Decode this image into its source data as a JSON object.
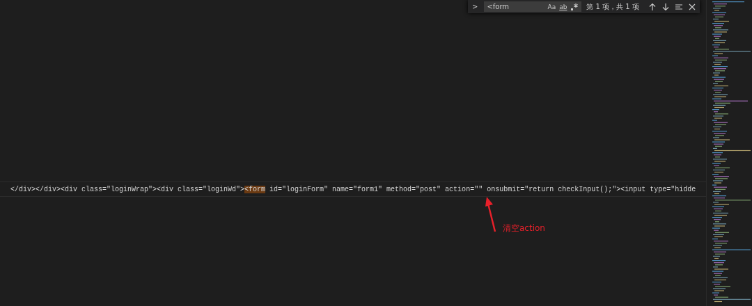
{
  "find_widget": {
    "expanded": false,
    "toggle": ">",
    "query": "<form",
    "match_case": false,
    "whole_word": false,
    "regex": false,
    "match_case_label": "Aa",
    "whole_word_label": "ab",
    "result": "第 1 项，共 1 项"
  },
  "code_line": {
    "before": "</div></div><div class=\"loginWrap\"><div class=\"loginWd\">",
    "match": "<form",
    "after": " id=\"loginForm\" name=\"form1\" method=\"post\" action=\"\" onsubmit=\"return checkInput();\"><input type=\"hidde"
  },
  "annotation": {
    "text": "清空action"
  }
}
